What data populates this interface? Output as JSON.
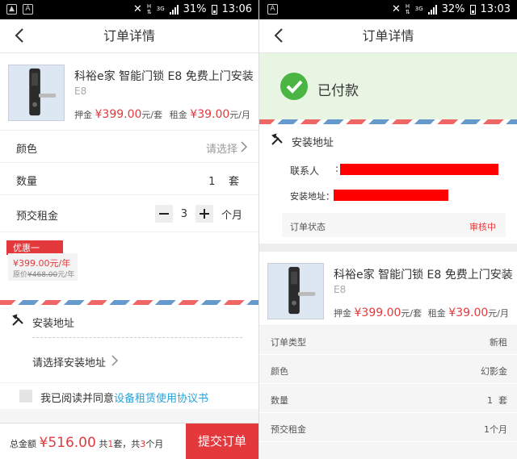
{
  "left": {
    "status": {
      "battery": "31%",
      "time": "13:06"
    },
    "header": {
      "title": "订单详情"
    },
    "product": {
      "name": "科裕e家 智能门锁 E8 免费上门安装",
      "model": "E8",
      "deposit_label": "押金",
      "deposit_value": "¥399.00",
      "deposit_unit": "元/套",
      "rent_label": "租金",
      "rent_value": "¥39.00",
      "rent_unit": "元/月"
    },
    "color": {
      "label": "颜色",
      "value": "请选择"
    },
    "qty": {
      "label": "数量",
      "value": "1",
      "unit": "套"
    },
    "prepay": {
      "label": "预交租金",
      "value": "3",
      "unit": "个月"
    },
    "promo": {
      "tag": "优惠一",
      "price": "¥399.00",
      "price_unit": "元/年",
      "orig_label": "原价",
      "orig_price": "¥468.00",
      "orig_unit": "元/年"
    },
    "address": {
      "title": "安装地址",
      "select": "请选择安装地址"
    },
    "agree": {
      "text": "我已阅读并同意",
      "link": "设备租赁使用协议书"
    },
    "footer": {
      "total_label": "总金额",
      "total": "¥516.00",
      "count_prefix": "共",
      "count": "1",
      "count_unit": "套，共",
      "months": "3",
      "months_unit": "个月",
      "submit": "提交订单"
    }
  },
  "right": {
    "status": {
      "battery": "32%",
      "time": "13:03"
    },
    "header": {
      "title": "订单详情"
    },
    "paid": {
      "text": "已付款"
    },
    "address": {
      "title": "安装地址",
      "contact_label": "联系人",
      "addr_label": "安装地址："
    },
    "order_status": {
      "label": "订单状态",
      "value": "审核中"
    },
    "product": {
      "name": "科裕e家 智能门锁 E8 免费上门安装",
      "model": "E8",
      "deposit_label": "押金",
      "deposit_value": "¥399.00",
      "deposit_unit": "元/套",
      "rent_label": "租金",
      "rent_value": "¥39.00",
      "rent_unit": "元/月"
    },
    "details": [
      {
        "label": "订单类型",
        "value": "新租"
      },
      {
        "label": "颜色",
        "value": "幻影金"
      },
      {
        "label": "数量",
        "value": "1  套"
      },
      {
        "label": "预交租金",
        "value": "1个月"
      }
    ]
  },
  "colors": {
    "accent": "#e4393c",
    "link": "#29a3d8",
    "success": "#4bb543"
  }
}
